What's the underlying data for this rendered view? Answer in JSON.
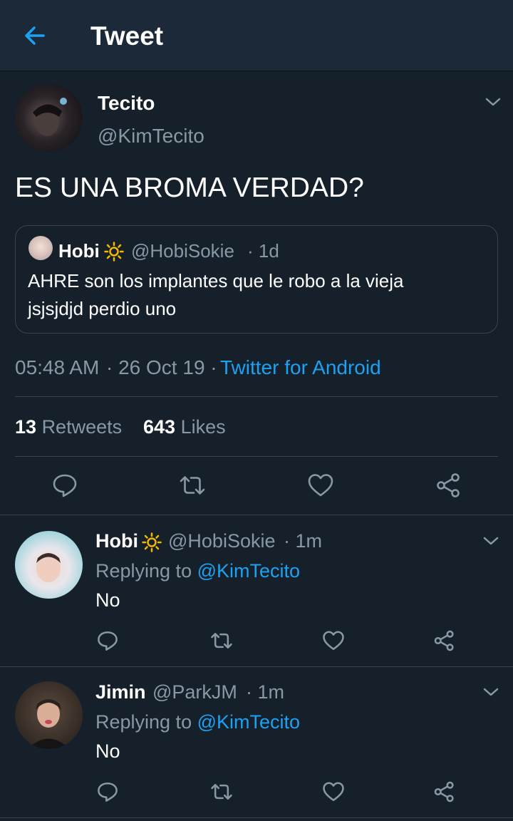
{
  "header": {
    "title": "Tweet"
  },
  "tweet": {
    "author_name": "Tecito",
    "author_handle": "@KimTecito",
    "text": "ES UNA BROMA VERDAD?",
    "quote": {
      "name": "Hobi",
      "handle": "@HobiSokie",
      "time": "· 1d",
      "text_line1": "AHRE son los implantes que le robo a la vieja",
      "text_line2": "jsjsjdjd perdio uno"
    },
    "time": "05:48 AM",
    "date": "· 26 Oct 19 ·",
    "source": "Twitter for Android",
    "retweets_count": "13",
    "retweets_label": "Retweets",
    "likes_count": "643",
    "likes_label": "Likes"
  },
  "replies": [
    {
      "name": "Hobi",
      "handle": "@HobiSokie",
      "time": "· 1m",
      "replying_label": "Replying to",
      "replying_to": "@KimTecito",
      "text": "No"
    },
    {
      "name": "Jimin",
      "handle": "@ParkJM",
      "time": "· 1m",
      "replying_label": "Replying to",
      "replying_to": "@KimTecito",
      "text": "No"
    }
  ],
  "icons": {
    "back": "arrow-left-icon",
    "chevron": "chevron-down-icon",
    "reply": "speech-bubble-icon",
    "retweet": "retweet-icon",
    "like": "heart-icon",
    "share": "share-icon",
    "sun": "sun-emoji-icon"
  },
  "colors": {
    "background": "#15202b",
    "header": "#1c2938",
    "accent": "#1da1f2",
    "muted": "#8899a6",
    "divider": "#38444d"
  }
}
